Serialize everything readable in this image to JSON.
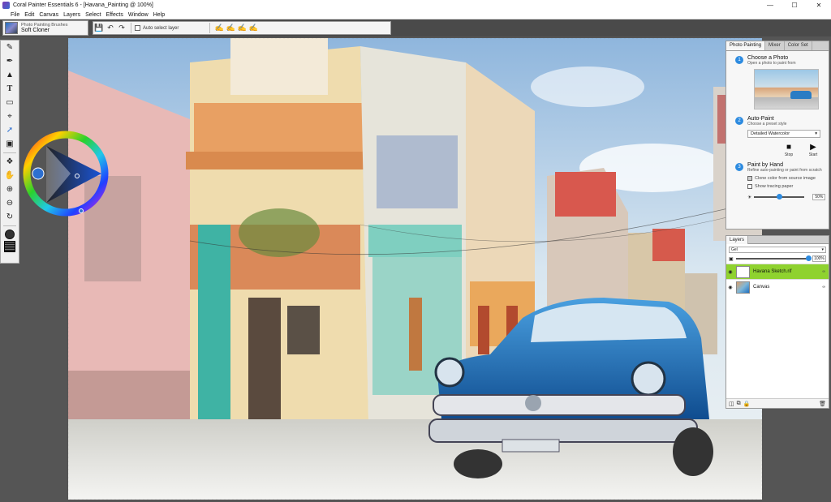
{
  "window": {
    "title": "Coral Painter Essentials 6 - [Havana_Painting @ 100%]",
    "controls": [
      "—",
      "☐",
      "✕"
    ]
  },
  "menu": {
    "items": [
      "File",
      "Edit",
      "Canvas",
      "Layers",
      "Select",
      "Effects",
      "Window",
      "Help"
    ]
  },
  "brush": {
    "category": "Photo Painting Brushes",
    "name": "Soft Cloner"
  },
  "toolbar": {
    "auto_select_label": "Auto select layer"
  },
  "toolbox": {
    "tools": [
      "brush-icon",
      "dropper-icon",
      "fill-icon",
      "text-icon",
      "eraser-icon",
      "crop-icon",
      "transform-icon",
      "selection-icon",
      "layer-adjust-icon",
      "hand-icon",
      "zoom-in-icon",
      "zoom-out-icon",
      "rotate-icon"
    ]
  },
  "photo_painting": {
    "tabs": [
      "Photo Painting",
      "Mixer",
      "Color Set"
    ],
    "step1": {
      "number": "1",
      "title": "Choose a Photo",
      "subtitle": "Open a photo to paint from"
    },
    "step2": {
      "number": "2",
      "title": "Auto-Paint",
      "subtitle": "Choose a preset style",
      "preset": "Detailed Watercolor",
      "stop_label": "Stop",
      "start_label": "Start"
    },
    "step3": {
      "number": "3",
      "title": "Paint by Hand",
      "subtitle": "Refine auto-painting or paint from scratch",
      "clone_color_label": "Clone color from source image",
      "tracing_paper_label": "Show tracing paper",
      "tracing_opacity": "50%",
      "tracing_opacity_value": 0.5
    }
  },
  "layers": {
    "tab": "Layers",
    "blend_mode": "Gel",
    "opacity": "100%",
    "items": [
      {
        "name": "Havana Sketch.rif",
        "selected": true
      },
      {
        "name": "Canvas",
        "selected": false
      }
    ]
  },
  "colors": {
    "accent": "#2d8be0",
    "selected_layer": "#8fd22f",
    "chrome_dark": "#4a4a4a"
  }
}
